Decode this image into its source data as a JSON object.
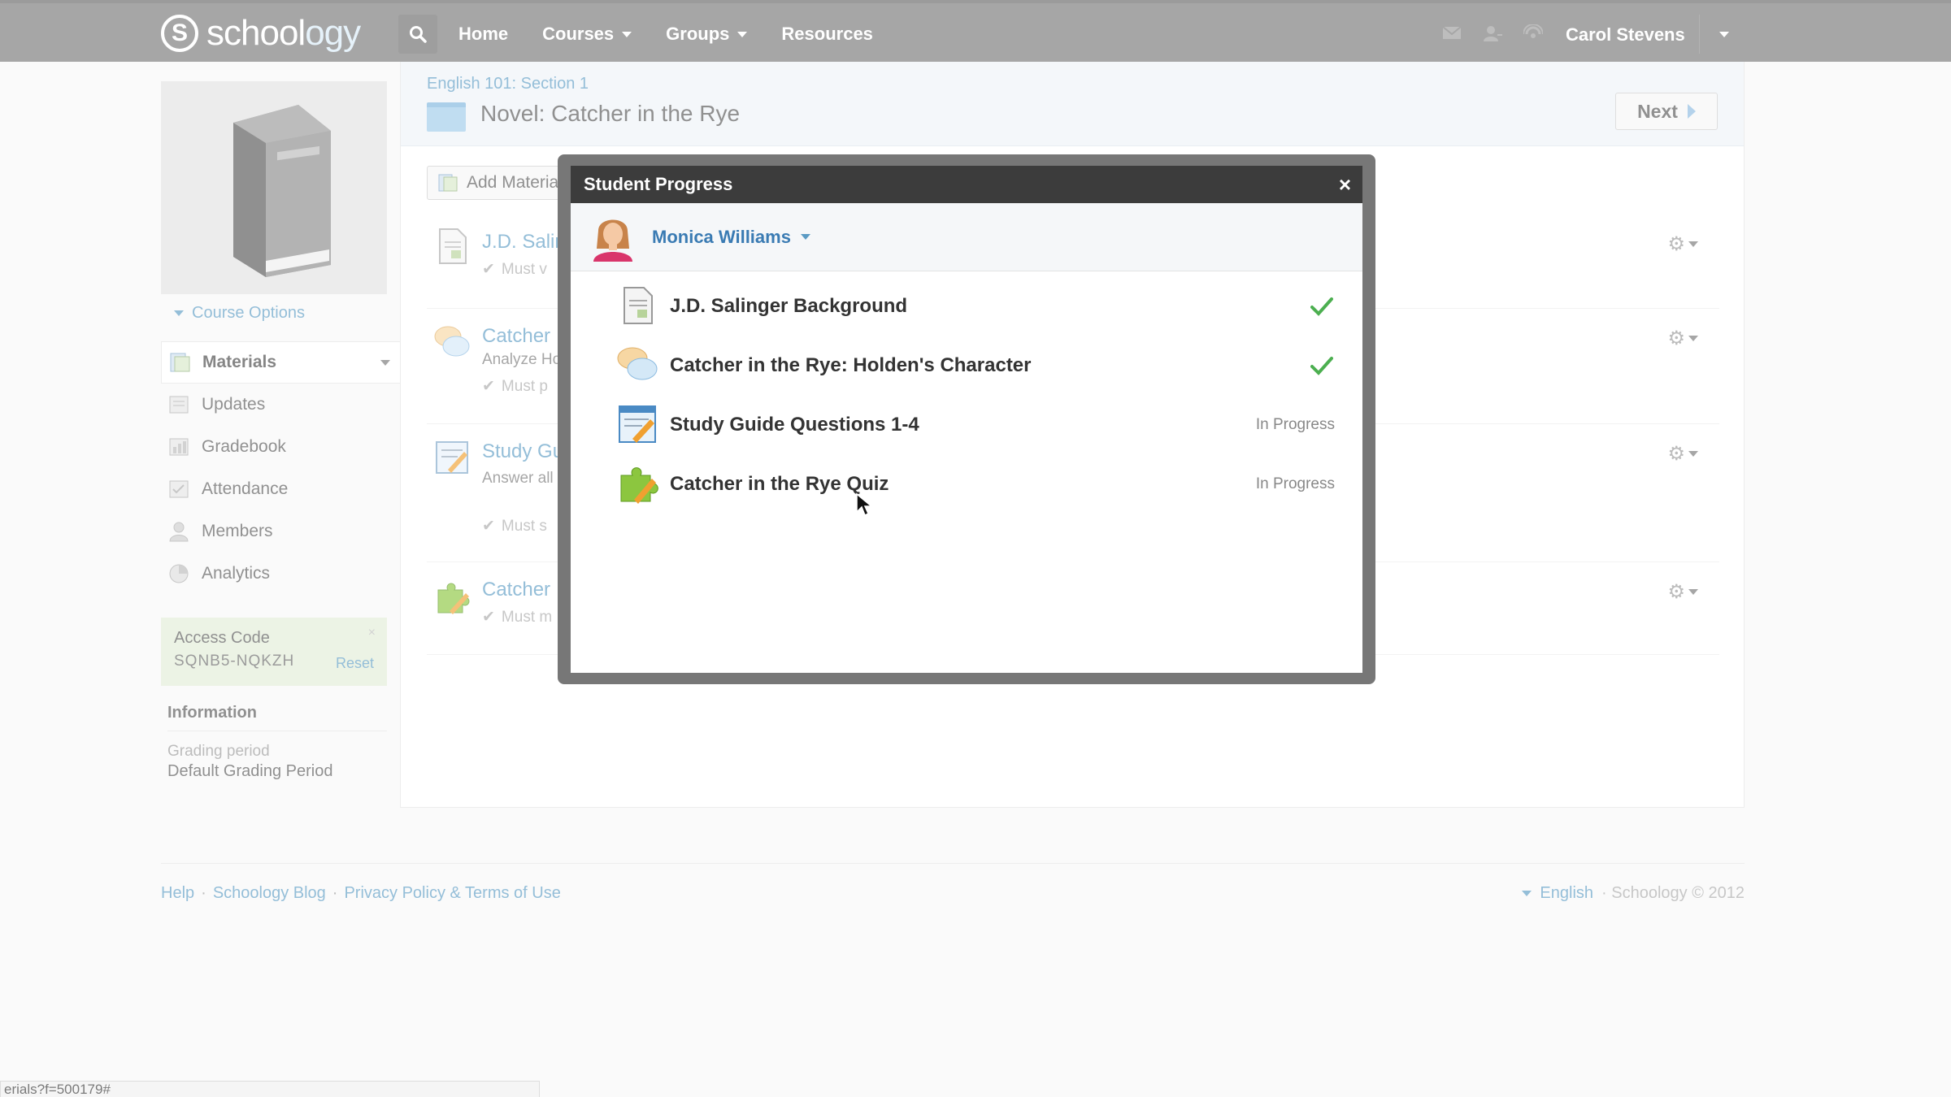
{
  "topbar": {
    "logo_letter": "S",
    "logo_text_main": "school",
    "logo_text_accent": "ogy",
    "nav": [
      {
        "label": "Home",
        "dropdown": false
      },
      {
        "label": "Courses",
        "dropdown": true
      },
      {
        "label": "Groups",
        "dropdown": true
      },
      {
        "label": "Resources",
        "dropdown": false
      }
    ],
    "user_name": "Carol Stevens"
  },
  "sidebar": {
    "course_options": "Course Options",
    "items": [
      {
        "label": "Materials",
        "icon": "materials-icon",
        "active": true
      },
      {
        "label": "Updates",
        "icon": "updates-icon",
        "active": false
      },
      {
        "label": "Gradebook",
        "icon": "gradebook-icon",
        "active": false
      },
      {
        "label": "Attendance",
        "icon": "attendance-icon",
        "active": false
      },
      {
        "label": "Members",
        "icon": "members-icon",
        "active": false
      },
      {
        "label": "Analytics",
        "icon": "analytics-icon",
        "active": false
      }
    ],
    "access": {
      "title": "Access Code",
      "code": "SQNB5-NQKZH",
      "reset": "Reset",
      "close": "×"
    },
    "information": {
      "title": "Information",
      "label": "Grading period",
      "value": "Default Grading Period"
    }
  },
  "main": {
    "breadcrumb": "English 101: Section 1",
    "title": "Novel: Catcher in the Rye",
    "next": "Next",
    "add_materials": "Add Materia",
    "materials": [
      {
        "title": "J.D. Salin",
        "desc": "",
        "must": "Must v"
      },
      {
        "title": "Catcher",
        "desc": "Analyze Ho",
        "must": "Must p"
      },
      {
        "title": "Study Gu",
        "desc": "Answer all",
        "must": "Must s"
      },
      {
        "title": "Catcher",
        "desc": "",
        "must": "Must m"
      }
    ]
  },
  "footer": {
    "links": [
      "Help",
      "Schoology Blog",
      "Privacy Policy & Terms of Use"
    ],
    "separator": "·",
    "language": "English",
    "copyright": "· Schoology © 2012"
  },
  "status_url": "erials?f=500179#",
  "modal": {
    "title": "Student Progress",
    "close": "×",
    "student": "Monica Williams",
    "items": [
      {
        "title": "J.D. Salinger Background",
        "icon": "document-icon",
        "status": "complete",
        "status_text": ""
      },
      {
        "title": "Catcher in the Rye: Holden's Character",
        "icon": "discussion-icon",
        "status": "complete",
        "status_text": ""
      },
      {
        "title": "Study Guide Questions 1-4",
        "icon": "assignment-icon",
        "status": "in-progress",
        "status_text": "In Progress"
      },
      {
        "title": "Catcher in the Rye Quiz",
        "icon": "quiz-icon",
        "status": "in-progress",
        "status_text": "In Progress"
      }
    ]
  },
  "colors": {
    "topbar": "#777777",
    "link": "#5b9bc4",
    "check": "#4caf50",
    "access_bg": "#e2edd8"
  }
}
